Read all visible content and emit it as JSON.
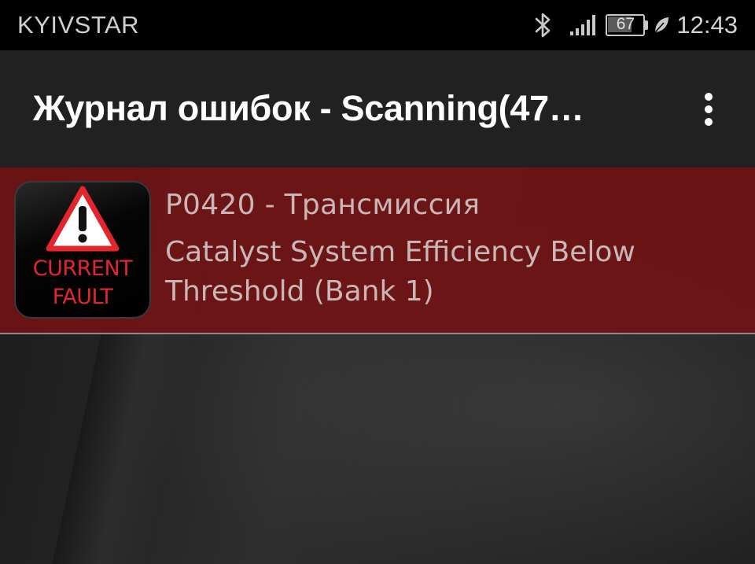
{
  "status_bar": {
    "carrier": "KYIVSTAR",
    "battery_level": "67",
    "battery_fraction": 0.67,
    "time": "12:43",
    "icons": [
      "bluetooth-icon",
      "signal-icon",
      "battery-icon",
      "battery-saver-leaf-icon"
    ]
  },
  "app_bar": {
    "title": "Журнал ошибок - Scanning(47…",
    "overflow_icon": "more-vert-icon"
  },
  "fault": {
    "icon_line1": "CURRENT",
    "icon_line2": "FAULT",
    "code_line": "P0420 - Трансмиссия",
    "description": "Catalyst System Efficiency Below Threshold (Bank 1)"
  },
  "colors": {
    "fault_row": "#741214",
    "fault_icon_text": "#e3262d",
    "app_bar": "#212121",
    "status_bar": "#000000"
  }
}
